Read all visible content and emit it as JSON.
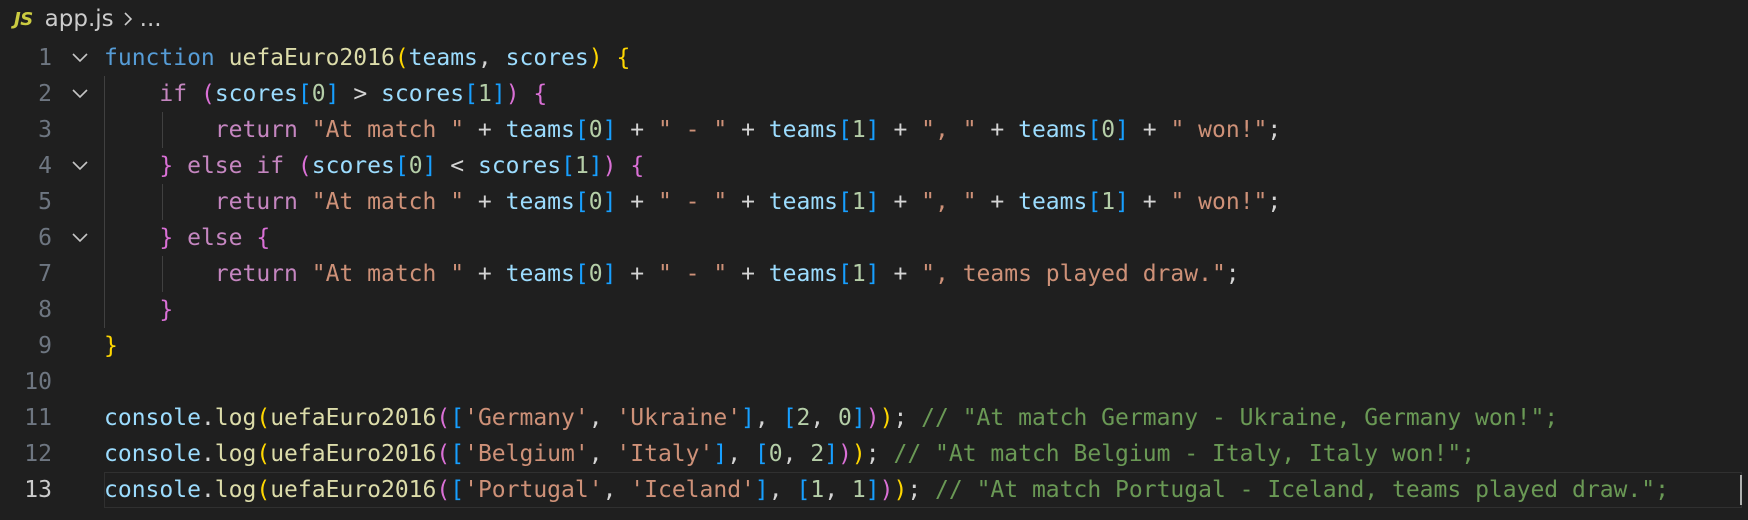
{
  "breadcrumb": {
    "file_badge": "JS",
    "file_name": "app.js",
    "more": "..."
  },
  "editor": {
    "current_line": 13,
    "lines": [
      {
        "n": "1",
        "fold": true
      },
      {
        "n": "2",
        "fold": true
      },
      {
        "n": "3",
        "fold": false
      },
      {
        "n": "4",
        "fold": true
      },
      {
        "n": "5",
        "fold": false
      },
      {
        "n": "6",
        "fold": true
      },
      {
        "n": "7",
        "fold": false
      },
      {
        "n": "8",
        "fold": false
      },
      {
        "n": "9",
        "fold": false
      },
      {
        "n": "10",
        "fold": false
      },
      {
        "n": "11",
        "fold": false
      },
      {
        "n": "12",
        "fold": false
      },
      {
        "n": "13",
        "fold": false
      }
    ],
    "tokens": [
      [
        [
          "kw",
          "function"
        ],
        [
          "op",
          " "
        ],
        [
          "fn",
          "uefaEuro2016"
        ],
        [
          "b1",
          "("
        ],
        [
          "var",
          "teams"
        ],
        [
          "op",
          ", "
        ],
        [
          "var",
          "scores"
        ],
        [
          "b1",
          ")"
        ],
        [
          "op",
          " "
        ],
        [
          "b1",
          "{"
        ]
      ],
      [
        [
          "op",
          "    "
        ],
        [
          "ctl",
          "if"
        ],
        [
          "op",
          " "
        ],
        [
          "b2",
          "("
        ],
        [
          "var",
          "scores"
        ],
        [
          "b3",
          "["
        ],
        [
          "num",
          "0"
        ],
        [
          "b3",
          "]"
        ],
        [
          "op",
          " > "
        ],
        [
          "var",
          "scores"
        ],
        [
          "b3",
          "["
        ],
        [
          "num",
          "1"
        ],
        [
          "b3",
          "]"
        ],
        [
          "b2",
          ")"
        ],
        [
          "op",
          " "
        ],
        [
          "b2",
          "{"
        ]
      ],
      [
        [
          "op",
          "        "
        ],
        [
          "ctl",
          "return"
        ],
        [
          "op",
          " "
        ],
        [
          "str",
          "\"At match \""
        ],
        [
          "op",
          " + "
        ],
        [
          "var",
          "teams"
        ],
        [
          "b3",
          "["
        ],
        [
          "num",
          "0"
        ],
        [
          "b3",
          "]"
        ],
        [
          "op",
          " + "
        ],
        [
          "str",
          "\" - \""
        ],
        [
          "op",
          " + "
        ],
        [
          "var",
          "teams"
        ],
        [
          "b3",
          "["
        ],
        [
          "num",
          "1"
        ],
        [
          "b3",
          "]"
        ],
        [
          "op",
          " + "
        ],
        [
          "str",
          "\", \""
        ],
        [
          "op",
          " + "
        ],
        [
          "var",
          "teams"
        ],
        [
          "b3",
          "["
        ],
        [
          "num",
          "0"
        ],
        [
          "b3",
          "]"
        ],
        [
          "op",
          " + "
        ],
        [
          "str",
          "\" won!\""
        ],
        [
          "op",
          ";"
        ]
      ],
      [
        [
          "op",
          "    "
        ],
        [
          "b2",
          "}"
        ],
        [
          "op",
          " "
        ],
        [
          "ctl",
          "else if"
        ],
        [
          "op",
          " "
        ],
        [
          "b2",
          "("
        ],
        [
          "var",
          "scores"
        ],
        [
          "b3",
          "["
        ],
        [
          "num",
          "0"
        ],
        [
          "b3",
          "]"
        ],
        [
          "op",
          " < "
        ],
        [
          "var",
          "scores"
        ],
        [
          "b3",
          "["
        ],
        [
          "num",
          "1"
        ],
        [
          "b3",
          "]"
        ],
        [
          "b2",
          ")"
        ],
        [
          "op",
          " "
        ],
        [
          "b2",
          "{"
        ]
      ],
      [
        [
          "op",
          "        "
        ],
        [
          "ctl",
          "return"
        ],
        [
          "op",
          " "
        ],
        [
          "str",
          "\"At match \""
        ],
        [
          "op",
          " + "
        ],
        [
          "var",
          "teams"
        ],
        [
          "b3",
          "["
        ],
        [
          "num",
          "0"
        ],
        [
          "b3",
          "]"
        ],
        [
          "op",
          " + "
        ],
        [
          "str",
          "\" - \""
        ],
        [
          "op",
          " + "
        ],
        [
          "var",
          "teams"
        ],
        [
          "b3",
          "["
        ],
        [
          "num",
          "1"
        ],
        [
          "b3",
          "]"
        ],
        [
          "op",
          " + "
        ],
        [
          "str",
          "\", \""
        ],
        [
          "op",
          " + "
        ],
        [
          "var",
          "teams"
        ],
        [
          "b3",
          "["
        ],
        [
          "num",
          "1"
        ],
        [
          "b3",
          "]"
        ],
        [
          "op",
          " + "
        ],
        [
          "str",
          "\" won!\""
        ],
        [
          "op",
          ";"
        ]
      ],
      [
        [
          "op",
          "    "
        ],
        [
          "b2",
          "}"
        ],
        [
          "op",
          " "
        ],
        [
          "ctl",
          "else"
        ],
        [
          "op",
          " "
        ],
        [
          "b2",
          "{"
        ]
      ],
      [
        [
          "op",
          "        "
        ],
        [
          "ctl",
          "return"
        ],
        [
          "op",
          " "
        ],
        [
          "str",
          "\"At match \""
        ],
        [
          "op",
          " + "
        ],
        [
          "var",
          "teams"
        ],
        [
          "b3",
          "["
        ],
        [
          "num",
          "0"
        ],
        [
          "b3",
          "]"
        ],
        [
          "op",
          " + "
        ],
        [
          "str",
          "\" - \""
        ],
        [
          "op",
          " + "
        ],
        [
          "var",
          "teams"
        ],
        [
          "b3",
          "["
        ],
        [
          "num",
          "1"
        ],
        [
          "b3",
          "]"
        ],
        [
          "op",
          " + "
        ],
        [
          "str",
          "\", teams played draw.\""
        ],
        [
          "op",
          ";"
        ]
      ],
      [
        [
          "op",
          "    "
        ],
        [
          "b2",
          "}"
        ]
      ],
      [
        [
          "b1",
          "}"
        ]
      ],
      [],
      [
        [
          "var",
          "console"
        ],
        [
          "op",
          "."
        ],
        [
          "fn",
          "log"
        ],
        [
          "b1",
          "("
        ],
        [
          "fn",
          "uefaEuro2016"
        ],
        [
          "b2",
          "("
        ],
        [
          "b3",
          "["
        ],
        [
          "str",
          "'Germany'"
        ],
        [
          "op",
          ", "
        ],
        [
          "str",
          "'Ukraine'"
        ],
        [
          "b3",
          "]"
        ],
        [
          "op",
          ", "
        ],
        [
          "b3",
          "["
        ],
        [
          "num",
          "2"
        ],
        [
          "op",
          ", "
        ],
        [
          "num",
          "0"
        ],
        [
          "b3",
          "]"
        ],
        [
          "b2",
          ")"
        ],
        [
          "b1",
          ")"
        ],
        [
          "op",
          "; "
        ],
        [
          "cmt",
          "// \"At match Germany - Ukraine, Germany won!\";"
        ]
      ],
      [
        [
          "var",
          "console"
        ],
        [
          "op",
          "."
        ],
        [
          "fn",
          "log"
        ],
        [
          "b1",
          "("
        ],
        [
          "fn",
          "uefaEuro2016"
        ],
        [
          "b2",
          "("
        ],
        [
          "b3",
          "["
        ],
        [
          "str",
          "'Belgium'"
        ],
        [
          "op",
          ", "
        ],
        [
          "str",
          "'Italy'"
        ],
        [
          "b3",
          "]"
        ],
        [
          "op",
          ", "
        ],
        [
          "b3",
          "["
        ],
        [
          "num",
          "0"
        ],
        [
          "op",
          ", "
        ],
        [
          "num",
          "2"
        ],
        [
          "b3",
          "]"
        ],
        [
          "b2",
          ")"
        ],
        [
          "b1",
          ")"
        ],
        [
          "op",
          "; "
        ],
        [
          "cmt",
          "// \"At match Belgium - Italy, Italy won!\";"
        ]
      ],
      [
        [
          "var",
          "console"
        ],
        [
          "op",
          "."
        ],
        [
          "fn",
          "log"
        ],
        [
          "b1",
          "("
        ],
        [
          "fn",
          "uefaEuro2016"
        ],
        [
          "b2",
          "("
        ],
        [
          "b3",
          "["
        ],
        [
          "str",
          "'Portugal'"
        ],
        [
          "op",
          ", "
        ],
        [
          "str",
          "'Iceland'"
        ],
        [
          "b3",
          "]"
        ],
        [
          "op",
          ", "
        ],
        [
          "b3",
          "["
        ],
        [
          "num",
          "1"
        ],
        [
          "op",
          ", "
        ],
        [
          "num",
          "1"
        ],
        [
          "b3",
          "]"
        ],
        [
          "b2",
          ")"
        ],
        [
          "b1",
          ")"
        ],
        [
          "op",
          "; "
        ],
        [
          "cmt",
          "// \"At match Portugal - Iceland, teams played draw.\";"
        ]
      ]
    ]
  }
}
